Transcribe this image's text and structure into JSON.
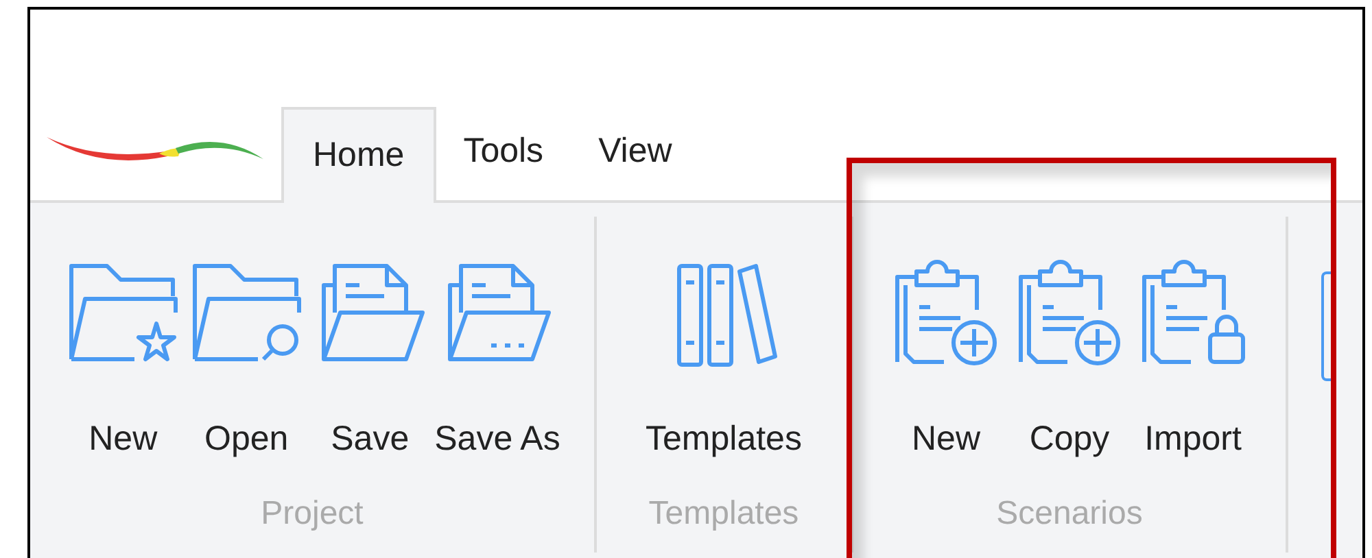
{
  "tabs": [
    {
      "label": "Home",
      "selected": true
    },
    {
      "label": "Tools",
      "selected": false
    },
    {
      "label": "View",
      "selected": false
    }
  ],
  "groups": [
    {
      "label": "Project",
      "buttons": [
        "New",
        "Open",
        "Save",
        "Save As"
      ]
    },
    {
      "label": "Templates",
      "buttons": [
        "Templates"
      ]
    },
    {
      "label": "Scenarios",
      "buttons": [
        "New",
        "Copy",
        "Import"
      ]
    }
  ]
}
